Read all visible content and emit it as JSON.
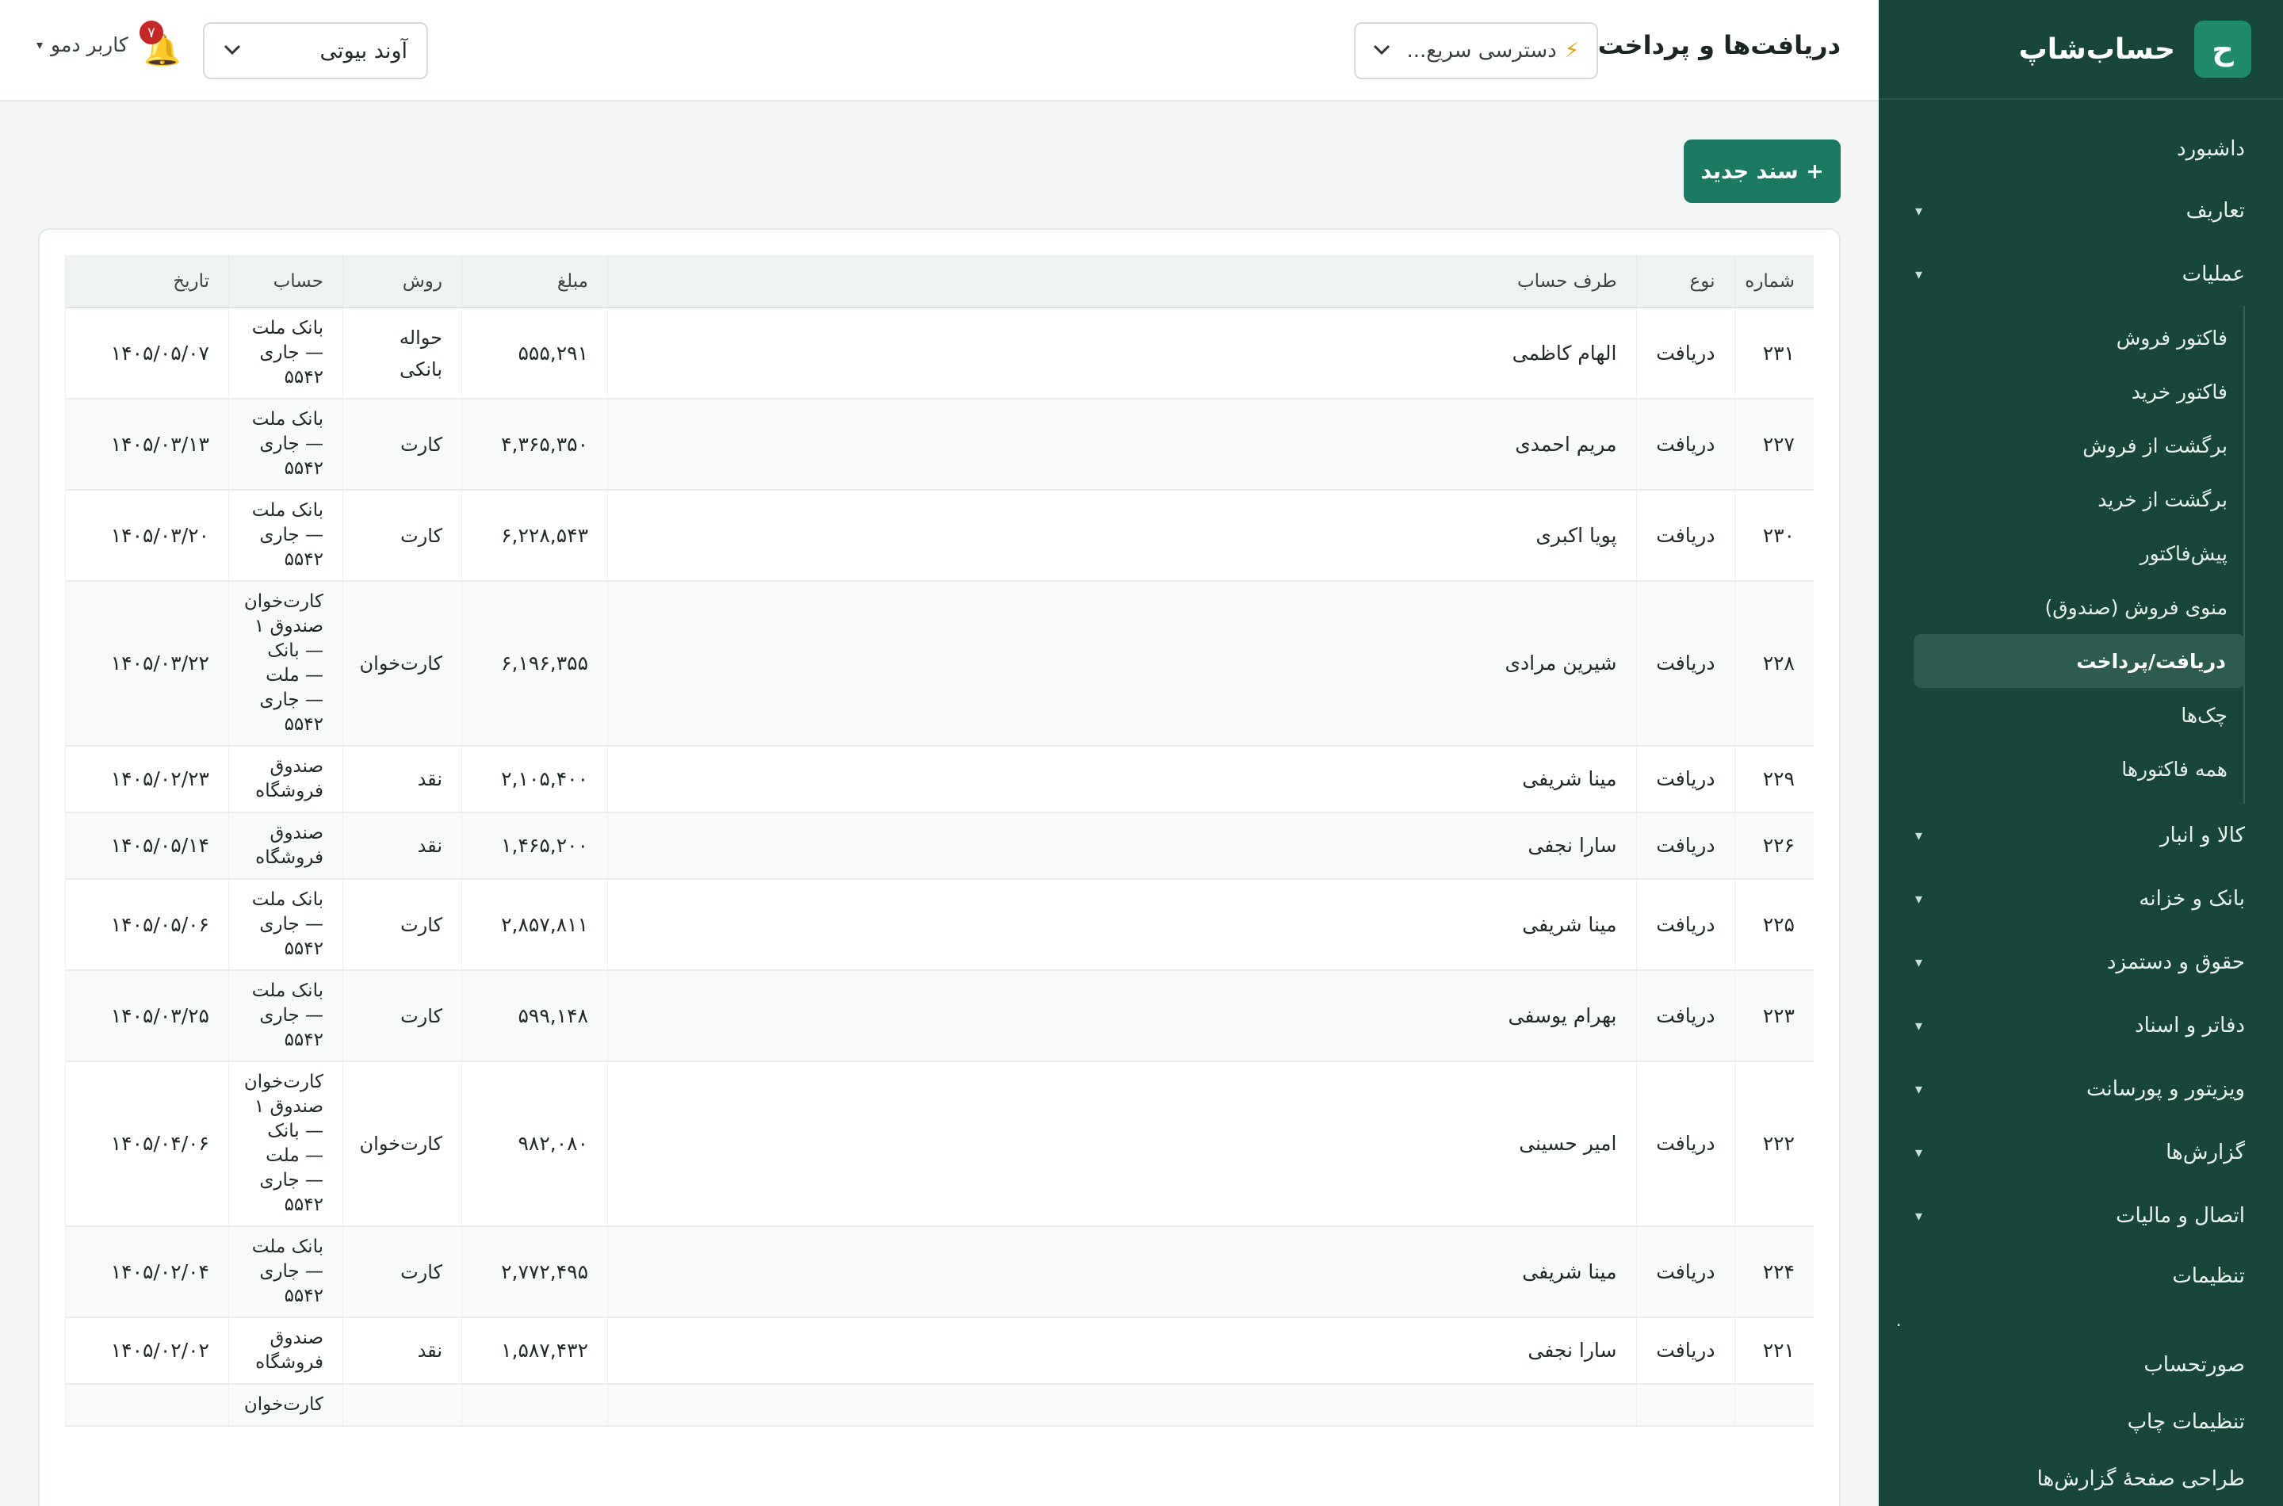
{
  "brand": {
    "logo_letter": "ح",
    "name": "حساب‌شاپ"
  },
  "sidebar": {
    "items": [
      {
        "label": "داشبورد",
        "caret": ""
      },
      {
        "label": "تعاریف",
        "caret": "▾"
      },
      {
        "label": "عملیات",
        "caret": "▾"
      }
    ],
    "operations_sub": [
      "فاکتور فروش",
      "فاکتور خرید",
      "برگشت از فروش",
      "برگشت از خرید",
      "پیش‌فاکتور",
      "منوی فروش (صندوق)",
      "دریافت/پرداخت",
      "چک‌ها",
      "همه فاکتورها"
    ],
    "more_items": [
      {
        "label": "کالا و انبار",
        "caret": "▾"
      },
      {
        "label": "بانک و خزانه",
        "caret": "▾"
      },
      {
        "label": "حقوق و دستمزد",
        "caret": "▾"
      },
      {
        "label": "دفاتر و اسناد",
        "caret": "▾"
      },
      {
        "label": "ویزیتور و پورسانت",
        "caret": "▾"
      },
      {
        "label": "گزارش‌ها",
        "caret": "▾"
      },
      {
        "label": "اتصال و مالیات",
        "caret": "▾"
      },
      {
        "label": "تنظیمات",
        "caret": ""
      }
    ],
    "dot": ".",
    "bottom_items": [
      "صورتحساب",
      "تنظیمات چاپ",
      "طراحی صفحهٔ گزارش‌ها"
    ]
  },
  "header": {
    "title": "دریافت‌ها و پرداخت‌ها",
    "quick_access": "دسترسی سریع...",
    "quick_access_icon": "⚡",
    "business": "آوند بیوتی",
    "notifications_count": "۷",
    "user": "کاربر دمو"
  },
  "toolbar": {
    "new_doc_label": "+ سند جدید"
  },
  "table": {
    "headers": {
      "number": "شماره",
      "type": "نوع",
      "party": "طرف حساب",
      "amount": "مبلغ",
      "method": "روش",
      "account": "حساب",
      "date": "تاریخ"
    },
    "rows": [
      {
        "number": "۲۳۱",
        "type": "دریافت",
        "party": "الهام کاظمی",
        "amount": "۵۵۵,۲۹۱",
        "method": "حواله بانکی",
        "account": "بانک ملت — جاری ۵۵۴۲",
        "date": "۱۴۰۵/۰۵/۰۷"
      },
      {
        "number": "۲۲۷",
        "type": "دریافت",
        "party": "مریم احمدی",
        "amount": "۴,۳۶۵,۳۵۰",
        "method": "کارت",
        "account": "بانک ملت — جاری ۵۵۴۲",
        "date": "۱۴۰۵/۰۳/۱۳"
      },
      {
        "number": "۲۳۰",
        "type": "دریافت",
        "party": "پویا اکبری",
        "amount": "۶,۲۲۸,۵۴۳",
        "method": "کارت",
        "account": "بانک ملت — جاری ۵۵۴۲",
        "date": "۱۴۰۵/۰۳/۲۰"
      },
      {
        "number": "۲۲۸",
        "type": "دریافت",
        "party": "شیرین مرادی",
        "amount": "۶,۱۹۶,۳۵۵",
        "method": "کارت‌خوان",
        "account": "کارت‌خوان صندوق ۱ — بانک — ملت — جاری ۵۵۴۲",
        "date": "۱۴۰۵/۰۳/۲۲"
      },
      {
        "number": "۲۲۹",
        "type": "دریافت",
        "party": "مینا شریفی",
        "amount": "۲,۱۰۵,۴۰۰",
        "method": "نقد",
        "account": "صندوق فروشگاه",
        "date": "۱۴۰۵/۰۲/۲۳"
      },
      {
        "number": "۲۲۶",
        "type": "دریافت",
        "party": "سارا نجفی",
        "amount": "۱,۴۶۵,۲۰۰",
        "method": "نقد",
        "account": "صندوق فروشگاه",
        "date": "۱۴۰۵/۰۵/۱۴"
      },
      {
        "number": "۲۲۵",
        "type": "دریافت",
        "party": "مینا شریفی",
        "amount": "۲,۸۵۷,۸۱۱",
        "method": "کارت",
        "account": "بانک ملت — جاری ۵۵۴۲",
        "date": "۱۴۰۵/۰۵/۰۶"
      },
      {
        "number": "۲۲۳",
        "type": "دریافت",
        "party": "بهرام یوسفی",
        "amount": "۵۹۹,۱۴۸",
        "method": "کارت",
        "account": "بانک ملت — جاری ۵۵۴۲",
        "date": "۱۴۰۵/۰۳/۲۵"
      },
      {
        "number": "۲۲۲",
        "type": "دریافت",
        "party": "امیر حسینی",
        "amount": "۹۸۲,۰۸۰",
        "method": "کارت‌خوان",
        "account": "کارت‌خوان صندوق ۱ — بانک — ملت — جاری ۵۵۴۲",
        "date": "۱۴۰۵/۰۴/۰۶"
      },
      {
        "number": "۲۲۴",
        "type": "دریافت",
        "party": "مینا شریفی",
        "amount": "۲,۷۷۲,۴۹۵",
        "method": "کارت",
        "account": "بانک ملت — جاری ۵۵۴۲",
        "date": "۱۴۰۵/۰۲/۰۴"
      },
      {
        "number": "۲۲۱",
        "type": "دریافت",
        "party": "سارا نجفی",
        "amount": "۱,۵۸۷,۴۳۲",
        "method": "نقد",
        "account": "صندوق فروشگاه",
        "date": "۱۴۰۵/۰۲/۰۲"
      },
      {
        "number": "",
        "type": "",
        "party": "",
        "amount": "",
        "method": "",
        "account": "کارت‌خوان",
        "date": ""
      }
    ]
  }
}
